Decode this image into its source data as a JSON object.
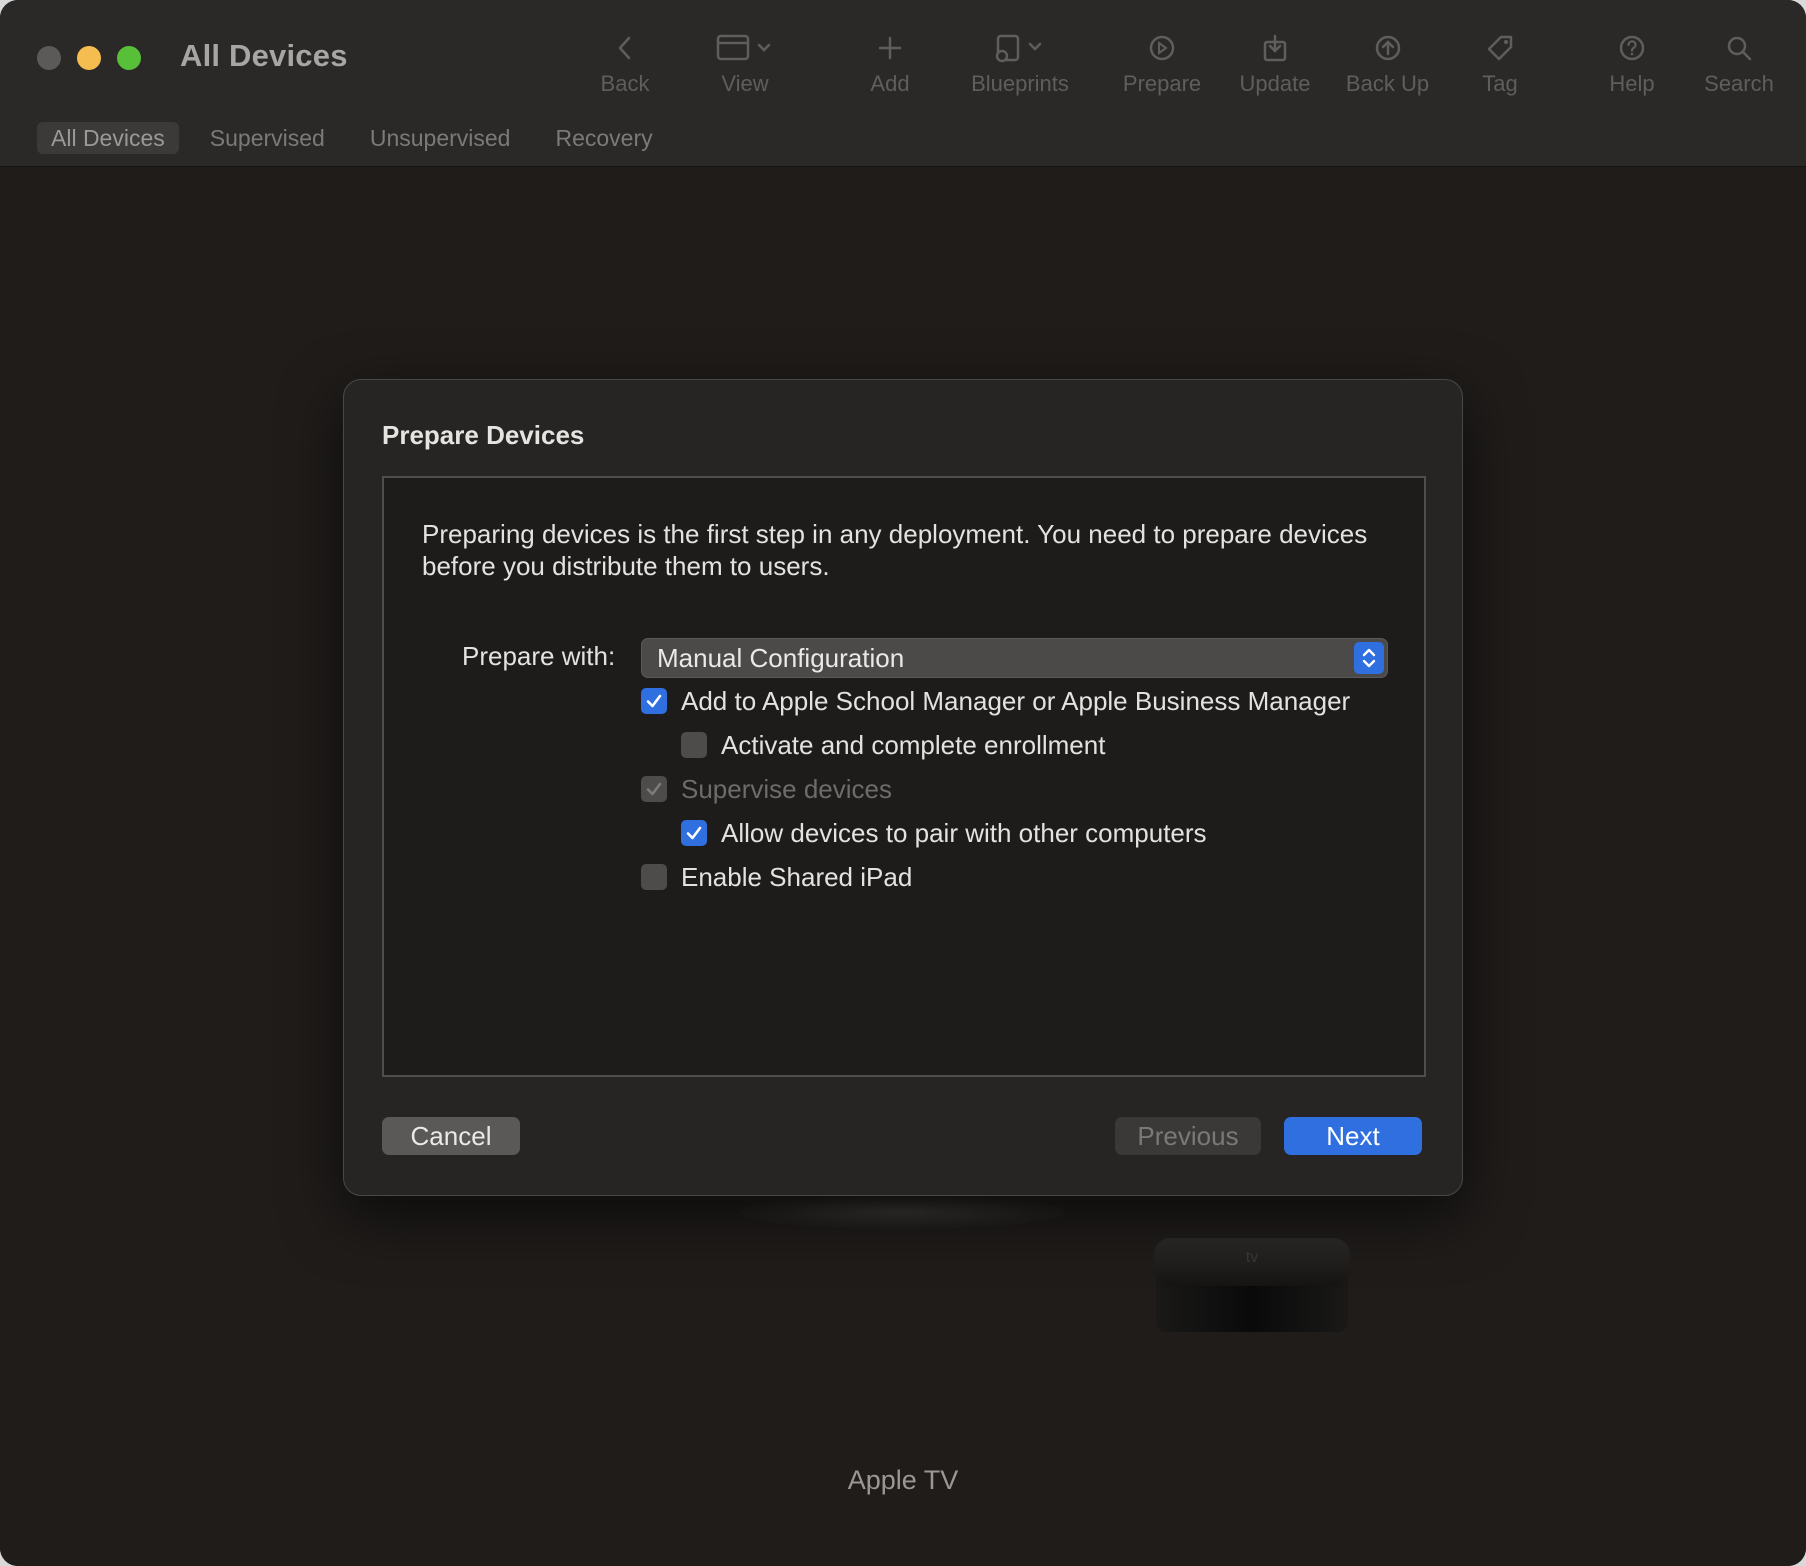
{
  "window": {
    "title": "All Devices"
  },
  "toolbar": {
    "items": [
      {
        "label": "Back",
        "icon": "chevron-left-icon"
      },
      {
        "label": "View",
        "icon": "view-icon"
      },
      {
        "label": "Add",
        "icon": "plus-icon"
      },
      {
        "label": "Blueprints",
        "icon": "blueprints-icon"
      },
      {
        "label": "Prepare",
        "icon": "prepare-icon"
      },
      {
        "label": "Update",
        "icon": "update-icon"
      },
      {
        "label": "Back Up",
        "icon": "backup-icon"
      },
      {
        "label": "Tag",
        "icon": "tag-icon"
      },
      {
        "label": "Help",
        "icon": "help-icon"
      },
      {
        "label": "Search",
        "icon": "search-icon"
      }
    ]
  },
  "tabs": [
    {
      "label": "All Devices",
      "active": true
    },
    {
      "label": "Supervised",
      "active": false
    },
    {
      "label": "Unsupervised",
      "active": false
    },
    {
      "label": "Recovery",
      "active": false
    }
  ],
  "dialog": {
    "title": "Prepare Devices",
    "intro": "Preparing devices is the first step in any deployment. You need to prepare devices before you distribute them to users.",
    "prepare_with_label": "Prepare with:",
    "prepare_with_value": "Manual Configuration",
    "options": [
      {
        "label": "Add to Apple School Manager or Apple Business Manager",
        "checked": true,
        "enabled": true
      },
      {
        "label": "Activate and complete enrollment",
        "checked": false,
        "enabled": true
      },
      {
        "label": "Supervise devices",
        "checked": true,
        "enabled": false
      },
      {
        "label": "Allow devices to pair with other computers",
        "checked": true,
        "enabled": true
      },
      {
        "label": "Enable Shared iPad",
        "checked": false,
        "enabled": true
      }
    ],
    "buttons": {
      "cancel": "Cancel",
      "previous": "Previous",
      "next": "Next"
    }
  },
  "device": {
    "label": "Apple TV"
  },
  "colors": {
    "accent": "#2f6fe0",
    "close": "#5b5a59",
    "minimize": "#f5bd4f",
    "maximize": "#57c038"
  }
}
